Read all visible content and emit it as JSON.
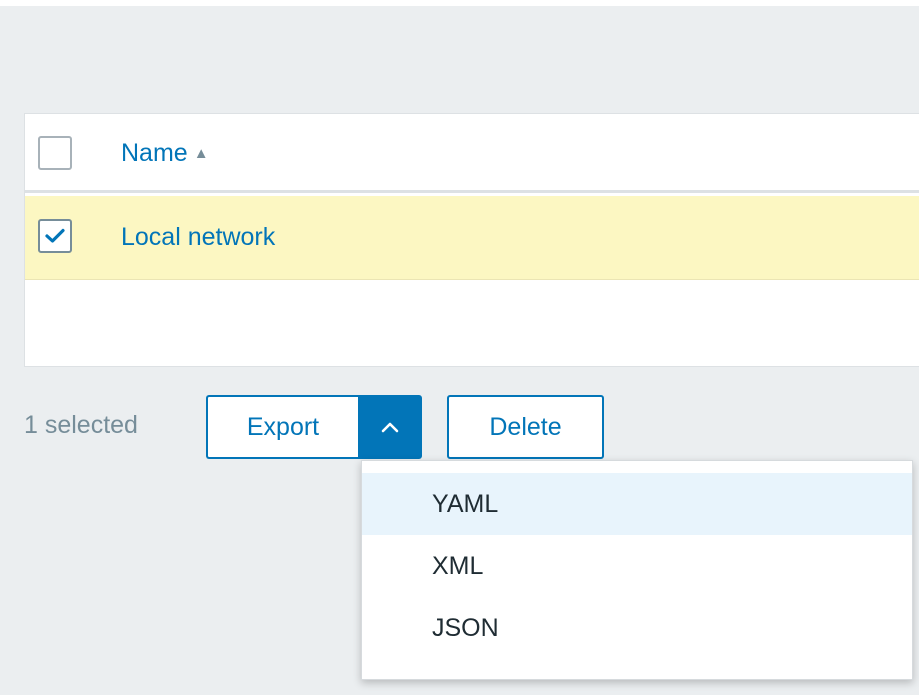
{
  "table": {
    "header": {
      "name_label": "Name",
      "sort_arrow": "▲",
      "select_all_checked": false
    },
    "rows": [
      {
        "name": "Local network",
        "checked": true
      }
    ]
  },
  "actions": {
    "selected_count": "1 selected",
    "export_label": "Export",
    "export_toggle_icon": "chevron-up-icon",
    "delete_label": "Delete"
  },
  "export_menu": {
    "items": [
      {
        "label": "YAML",
        "highlighted": true
      },
      {
        "label": "XML",
        "highlighted": false
      },
      {
        "label": "JSON",
        "highlighted": false
      }
    ]
  },
  "colors": {
    "accent": "#0275b8",
    "background": "#ebeef0",
    "selected_row": "#fcf7c2",
    "muted_text": "#768d99",
    "menu_highlight": "#e8f4fc"
  }
}
